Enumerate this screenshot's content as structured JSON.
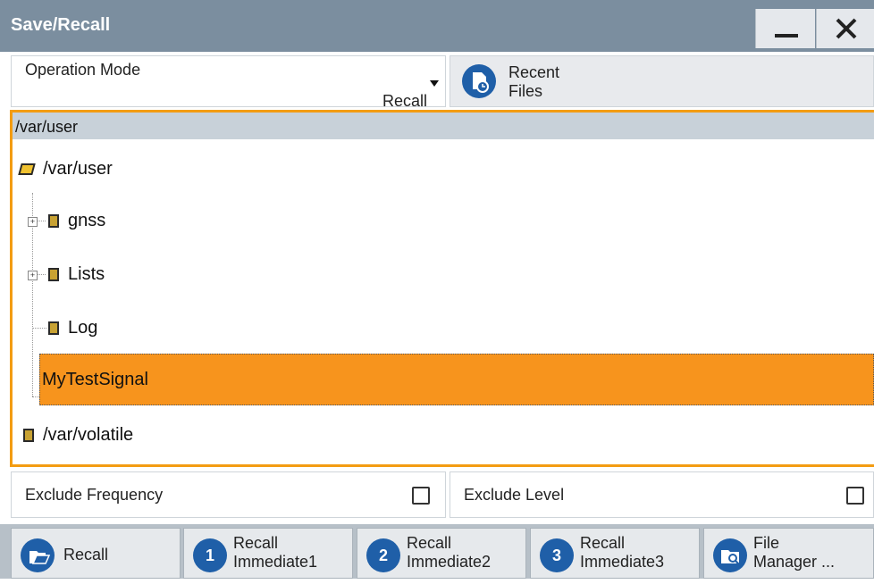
{
  "window": {
    "title": "Save/Recall"
  },
  "operation_mode": {
    "label": "Operation Mode",
    "value": "Recall"
  },
  "recent_files": {
    "line1": "Recent",
    "line2": "Files",
    "icon": "recent-files-icon"
  },
  "browser": {
    "path": "/var/user",
    "tree": [
      {
        "label": "/var/user"
      },
      {
        "label": "gnss"
      },
      {
        "label": "Lists"
      },
      {
        "label": "Log"
      },
      {
        "label": "MyTestSignal"
      },
      {
        "label": "/var/volatile"
      }
    ],
    "selected_color": "#f7941d"
  },
  "exclude_frequency": {
    "label": "Exclude Frequency",
    "checked": false
  },
  "exclude_level": {
    "label": "Exclude Level",
    "checked": false
  },
  "buttons": [
    {
      "line1": "Recall",
      "line2": ""
    },
    {
      "line1": "Recall",
      "line2": "Immediate1"
    },
    {
      "line1": "Recall",
      "line2": "Immediate2"
    },
    {
      "line1": "Recall",
      "line2": "Immediate3"
    },
    {
      "line1": "File",
      "line2": "Manager ..."
    }
  ],
  "colors": {
    "titlebar": "#7b8e9f",
    "accent": "#f39c12",
    "icon_blue": "#1f5fa8"
  }
}
